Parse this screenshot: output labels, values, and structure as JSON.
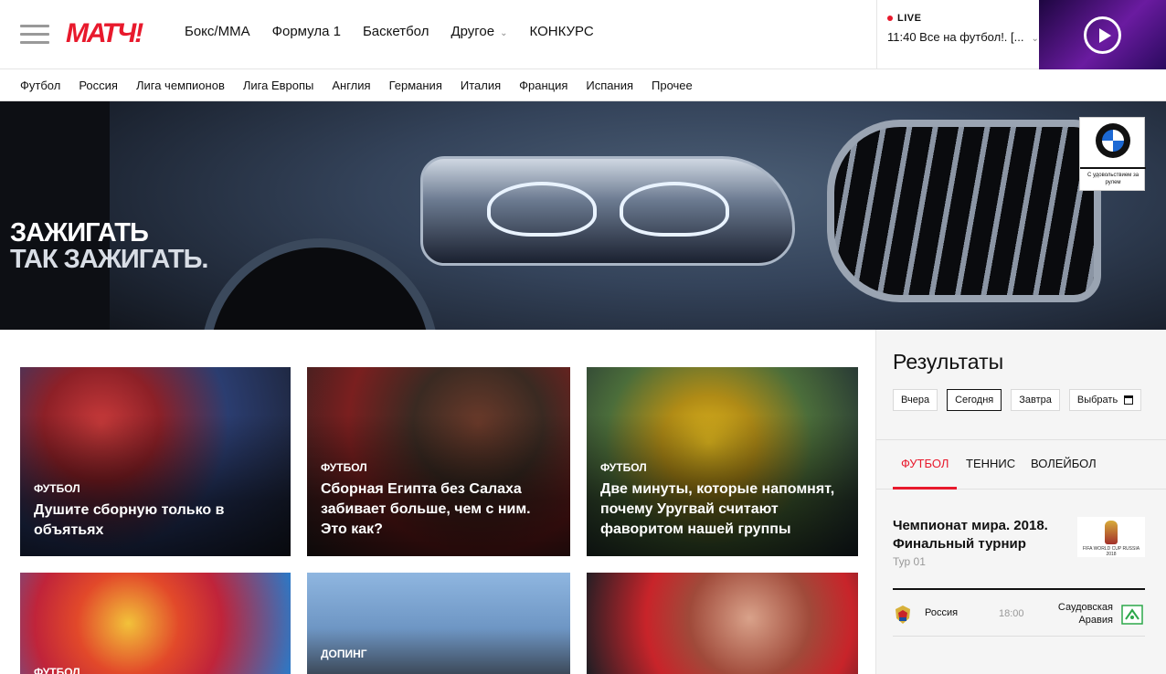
{
  "brand": {
    "logo_text": "МАТЧ!",
    "accent_color": "#e8192c"
  },
  "main_nav": [
    "Бокс/ММА",
    "Формула 1",
    "Баскетбол",
    "Другое",
    "КОНКУРС"
  ],
  "live": {
    "badge": "LIVE",
    "program": "11:40 Все на футбол!. [..."
  },
  "sub_nav": [
    "Футбол",
    "Россия",
    "Лига чемпионов",
    "Лига Европы",
    "Англия",
    "Германия",
    "Италия",
    "Франция",
    "Испания",
    "Прочее"
  ],
  "banner": {
    "line1": "ЗАЖИГАТЬ",
    "line2": "ТАК ЗАЖИГАТЬ.",
    "sponsor_tagline": "С удовольствием за рулем"
  },
  "cards": [
    {
      "category": "Футбол",
      "title": "Душите сборную только в объятьях"
    },
    {
      "category": "Футбол",
      "title": "Сборная Египта без Салаха забивает больше, чем с ним. Это как?"
    },
    {
      "category": "Футбол",
      "title": "Две минуты, которые напомнят, почему Уругвай считают фаворитом нашей группы"
    },
    {
      "category": "Футбол",
      "title": ""
    },
    {
      "category": "Допинг",
      "title": ""
    },
    {
      "category": "",
      "title": ""
    }
  ],
  "results": {
    "heading": "Результаты",
    "date_filters": [
      "Вчера",
      "Сегодня",
      "Завтра",
      "Выбрать"
    ],
    "active_date": "Сегодня",
    "sports_tabs": [
      "ФУТБОЛ",
      "ТЕННИС",
      "ВОЛЕЙБОЛ"
    ],
    "active_tab": "ФУТБОЛ",
    "tournament": "Чемпионат мира. 2018. Финальный турнир",
    "round": "Тур 01",
    "match": {
      "home": "Россия",
      "time": "18:00",
      "away": "Саудовская Аравия"
    }
  }
}
